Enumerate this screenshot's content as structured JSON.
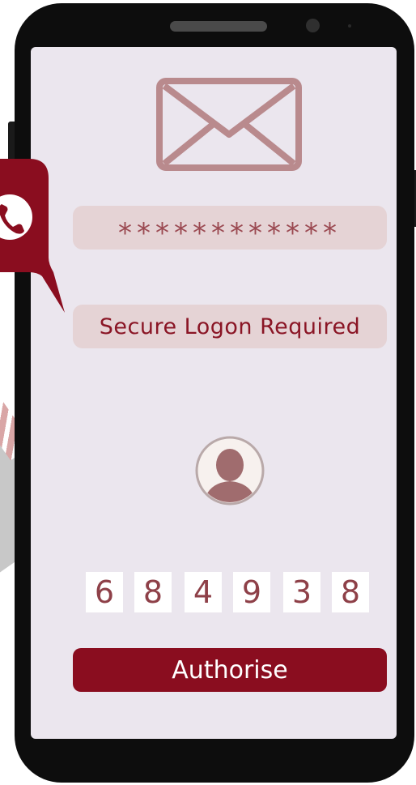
{
  "colors": {
    "accent": "#8a0d1f",
    "field_bg": "#e5d3d5",
    "screen_bg": "#ebe6ee",
    "icon_rose": "#b98a8d",
    "phone_body": "#0d0d0d"
  },
  "icons": {
    "mail": "envelope-icon",
    "call": "phone-icon",
    "user": "user-avatar-icon"
  },
  "login": {
    "password_mask": "************",
    "status_label": "Secure Logon Required"
  },
  "verification": {
    "code_digits": [
      "6",
      "8",
      "4",
      "9",
      "3",
      "8"
    ]
  },
  "actions": {
    "authorise_label": "Authorise"
  }
}
